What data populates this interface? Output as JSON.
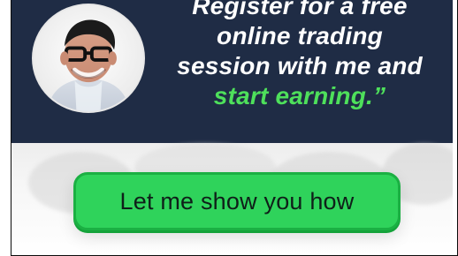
{
  "banner": {
    "quote_lines": [
      "Register for a free",
      "online trading",
      "session with me and",
      "start earning.”"
    ],
    "cta_label": "Let me show you how"
  },
  "colors": {
    "top_bg": "#1f2c45",
    "accent_green": "#4ee05b",
    "button_green": "#2fd35b",
    "button_border": "#1bb043"
  },
  "icons": {
    "avatar": "person-avatar-icon"
  }
}
